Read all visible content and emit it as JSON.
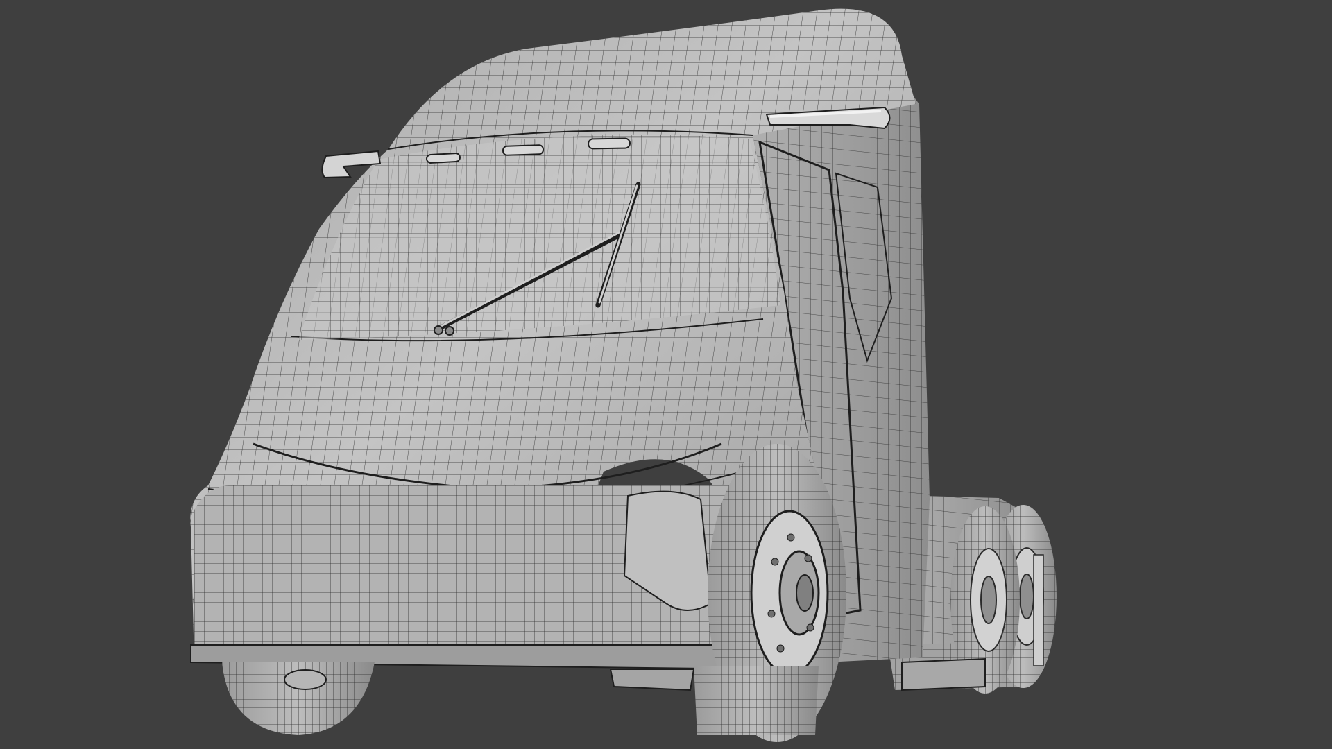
{
  "viewport": {
    "background": "#3f3f3f",
    "display_mode": "wireframe-on-shaded"
  },
  "model": {
    "subject": "semi-truck-cab",
    "body_color": "#b9b9b9",
    "wire_color": "#2b2b2b",
    "parts": [
      "cab-body",
      "windshield",
      "wiper-left",
      "wiper-right",
      "roof-marker-lights",
      "mirror-left",
      "mirror-right",
      "front-bumper",
      "side-door",
      "front-wheel-left",
      "front-wheel-right",
      "rear-axle-wheels",
      "chassis-frame"
    ]
  }
}
